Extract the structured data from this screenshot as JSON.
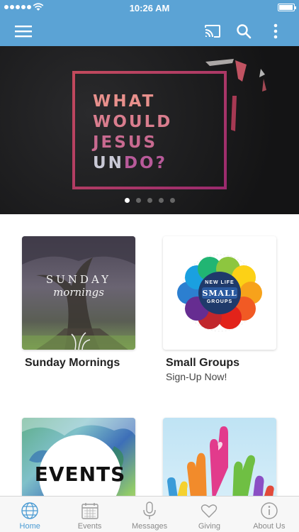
{
  "status_bar": {
    "time": "10:26 AM"
  },
  "hero": {
    "title_lines": [
      "WHAT",
      "WOULD",
      "JESUS"
    ],
    "title_last_a": "UN",
    "title_last_b": "DO?",
    "slide_count": 5,
    "active_slide": 1
  },
  "cards": [
    {
      "title": "Sunday Mornings",
      "subtitle": "",
      "thumb_text_1": "SUNDAY",
      "thumb_text_2": "mornings"
    },
    {
      "title": "Small Groups",
      "subtitle": "Sign-Up Now!",
      "thumb_text_1": "NEW LIFE",
      "thumb_text_2": "SMALL",
      "thumb_text_3": "GROUPS"
    },
    {
      "title": "",
      "subtitle": "",
      "thumb_text_1": "EVENTS"
    },
    {
      "title": "",
      "subtitle": ""
    }
  ],
  "tabs": [
    {
      "label": "Home",
      "icon": "globe-icon",
      "active": true
    },
    {
      "label": "Events",
      "icon": "calendar-icon",
      "active": false
    },
    {
      "label": "Messages",
      "icon": "microphone-icon",
      "active": false
    },
    {
      "label": "Giving",
      "icon": "heart-icon",
      "active": false
    },
    {
      "label": "About Us",
      "icon": "info-icon",
      "active": false
    }
  ],
  "colors": {
    "nav_blue": "#5ba3d5",
    "tab_active": "#4b9bd3",
    "hero_accent": "#c0405e"
  }
}
